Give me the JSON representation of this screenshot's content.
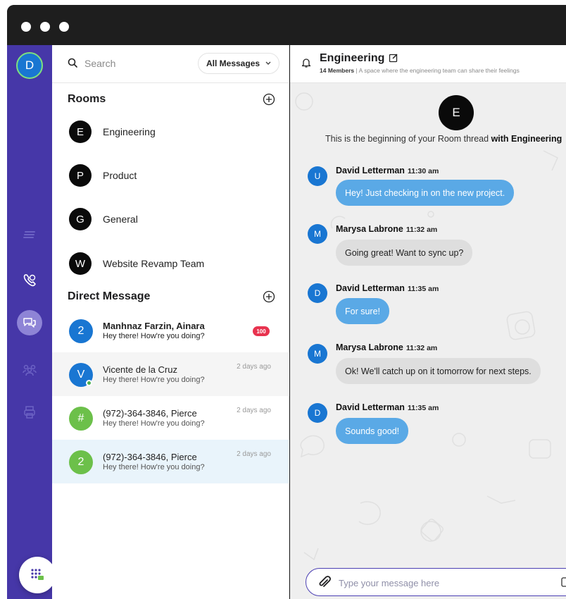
{
  "sidebar": {
    "user_initial": "D",
    "colors": {
      "rail": "#4637a8",
      "active": "#8e84d6",
      "online": "#7ee07e"
    },
    "nav": [
      {
        "icon": "stack-icon",
        "active": false
      },
      {
        "icon": "phone-icon",
        "active": false
      },
      {
        "icon": "chat-icon",
        "active": true
      },
      {
        "icon": "people-icon",
        "active": false
      },
      {
        "icon": "printer-icon",
        "active": false
      }
    ],
    "dialpad_icon": "dialpad-icon"
  },
  "list": {
    "search_placeholder": "Search",
    "filter_label": "All Messages",
    "rooms_title": "Rooms",
    "rooms": [
      {
        "initial": "E",
        "label": "Engineering"
      },
      {
        "initial": "P",
        "label": "Product"
      },
      {
        "initial": "G",
        "label": "General"
      },
      {
        "initial": "W",
        "label": "Website Revamp Team"
      }
    ],
    "dm_title": "Direct Message",
    "dms": [
      {
        "initial": "2",
        "name": "Manhnaz Farzin, Ainara",
        "message": "Hey there! How're you doing?",
        "time": "",
        "badge": "100",
        "color": "#1976d2",
        "unread": true
      },
      {
        "initial": "V",
        "name": "Vicente de la Cruz",
        "message": "Hey there! How're you doing?",
        "time": "2 days ago",
        "badge": "",
        "color": "#1976d2",
        "online": true
      },
      {
        "initial": "#",
        "name": "(972)-364-3846, Pierce",
        "message": "Hey there! How're you doing?",
        "time": "2 days ago",
        "badge": "",
        "color": "#6cc04a"
      },
      {
        "initial": "2",
        "name": "(972)-364-3846, Pierce",
        "message": "Hey there! How're you doing?",
        "time": "2 days ago",
        "badge": "",
        "color": "#6cc04a",
        "selected": true
      }
    ]
  },
  "chat": {
    "room_title": "Engineering",
    "members": "14 Members",
    "separator": "|",
    "description": "A space where the engineering team can share their feelings",
    "room_initial": "E",
    "thread_start_prefix": "This is the beginning of your Room thread",
    "thread_start_bold": "with Engineering",
    "messages": [
      {
        "initial": "U",
        "author": "David Letterman",
        "time": "11:30 am",
        "text": "Hey! Just checking in on the new project.",
        "mine": true
      },
      {
        "initial": "M",
        "author": "Marysa Labrone",
        "time": "11:32 am",
        "text": "Going great! Want to sync up?",
        "mine": false
      },
      {
        "initial": "D",
        "author": "David Letterman",
        "time": "11:35 am",
        "text": "For sure!",
        "mine": true
      },
      {
        "initial": "M",
        "author": "Marysa Labrone",
        "time": "11:32 am",
        "text": "Ok! We'll catch up on it tomorrow for next steps.",
        "mine": false
      },
      {
        "initial": "D",
        "author": "David Letterman",
        "time": "11:35 am",
        "text": "Sounds good!",
        "mine": true
      }
    ],
    "composer_placeholder": "Type your message here"
  }
}
